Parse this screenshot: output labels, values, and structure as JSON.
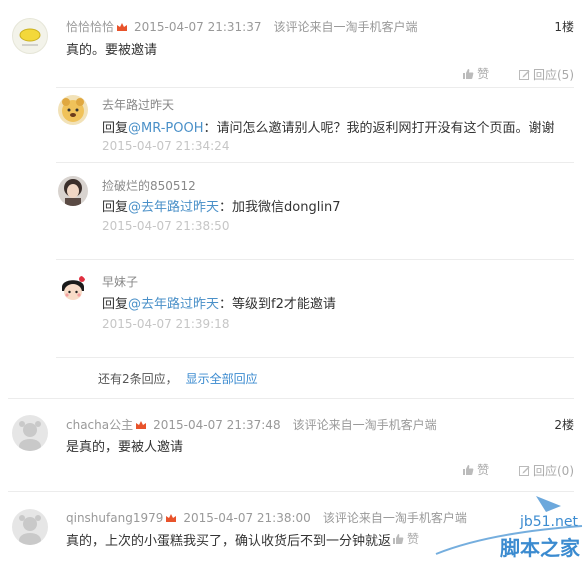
{
  "comments": [
    {
      "username": "恰恰恰恰",
      "time": "2015-04-07 21:31:37",
      "source": "该评论来自一淘手机客户端",
      "floor": "1楼",
      "content": "真的。要被邀请",
      "like_label": "赞",
      "reply_label": "回应(5)"
    },
    {
      "username": "chacha公主",
      "time": "2015-04-07 21:37:48",
      "source": "该评论来自一淘手机客户端",
      "floor": "2楼",
      "content": "是真的，要被人邀请",
      "like_label": "赞",
      "reply_label": "回应(0)"
    },
    {
      "username": "qinshufang1979",
      "time": "2015-04-07 21:38:00",
      "source": "该评论来自一淘手机客户端",
      "content": "真的，上次的小蛋糕我买了，确认收货后不到一分钟就返",
      "like_label": "赞"
    }
  ],
  "replies": [
    {
      "username": "去年路过昨天",
      "prefix": "回复",
      "mention": "@MR-POOH",
      "text": "：请问怎么邀请别人呢？我的返利网打开没有这个页面。谢谢",
      "time": "2015-04-07 21:34:24"
    },
    {
      "username": "捡破烂的850512",
      "prefix": "回复",
      "mention": "@去年路过昨天",
      "text": "：加我微信donglin7",
      "time": "2015-04-07 21:38:50"
    },
    {
      "username": "早妹子",
      "prefix": "回复",
      "mention": "@去年路过昨天",
      "text": "：等级到f2才能邀请",
      "time": "2015-04-07 21:39:18"
    }
  ],
  "more_replies": {
    "text": "还有2条回应，",
    "link": "显示全部回应"
  },
  "watermark": {
    "url": "jb51.net",
    "text": "脚本之家"
  },
  "colors": {
    "mention": "#4a90c8",
    "link": "#3b8bd0",
    "crown": "#e8532b"
  }
}
